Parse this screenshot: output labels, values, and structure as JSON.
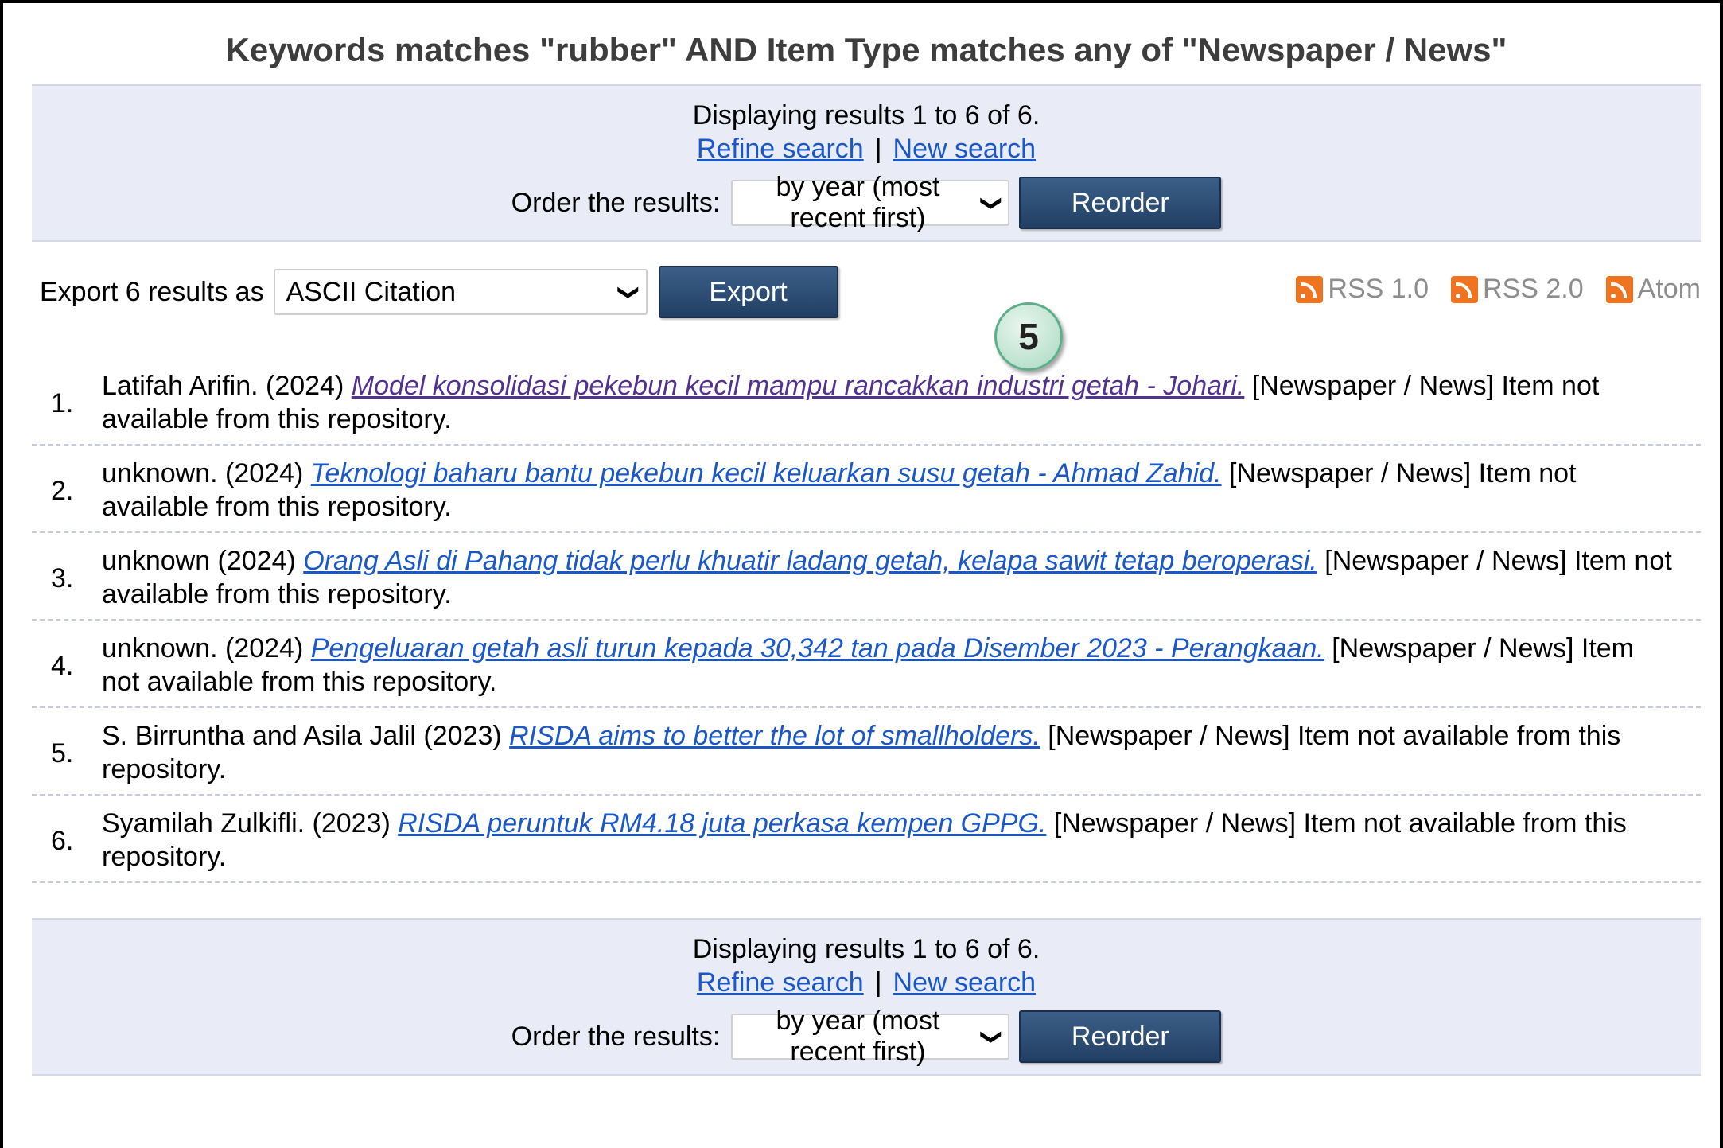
{
  "title": "Keywords matches \"rubber\" AND Item Type matches any of \"Newspaper / News\"",
  "top_bar": {
    "summary": "Displaying results 1 to 6 of 6.",
    "refine_label": "Refine search",
    "separator": "|",
    "new_search_label": "New search",
    "order_label": "Order the results:",
    "order_selected": "by year (most recent first)",
    "reorder_label": "Reorder"
  },
  "export": {
    "label": "Export 6 results as",
    "format_selected": "ASCII Citation",
    "button_label": "Export"
  },
  "feeds": [
    {
      "label": "RSS 1.0",
      "icon": "rss-icon"
    },
    {
      "label": "RSS 2.0",
      "icon": "rss-icon"
    },
    {
      "label": "Atom",
      "icon": "rss-icon"
    }
  ],
  "step_badge": "5",
  "results": [
    {
      "num": "1.",
      "prefix": "Latifah Arifin. (2024) ",
      "link": "Model konsolidasi pekebun kecil mampu rancakkan industri getah - Johari.",
      "suffix": " [Newspaper / News] Item not available from this repository."
    },
    {
      "num": "2.",
      "prefix": "unknown. (2024) ",
      "link": "Teknologi baharu bantu pekebun kecil keluarkan susu getah - Ahmad Zahid.",
      "suffix": " [Newspaper / News] Item not available from this repository."
    },
    {
      "num": "3.",
      "prefix": "unknown (2024) ",
      "link": "Orang Asli di Pahang tidak perlu khuatir ladang getah, kelapa sawit tetap beroperasi.",
      "suffix": " [Newspaper / News] Item not available from this repository."
    },
    {
      "num": "4.",
      "prefix": "unknown. (2024) ",
      "link": "Pengeluaran getah asli turun kepada 30,342 tan pada Disember 2023 - Perangkaan.",
      "suffix": " [Newspaper / News] Item not available from this repository."
    },
    {
      "num": "5.",
      "prefix": "S. Birruntha and Asila Jalil (2023) ",
      "link": "RISDA aims to better the lot of smallholders.",
      "suffix": " [Newspaper / News] Item not available from this repository."
    },
    {
      "num": "6.",
      "prefix": "Syamilah Zulkifli. (2023) ",
      "link": "RISDA peruntuk RM4.18 juta perkasa kempen GPPG.",
      "suffix": " [Newspaper / News] Item not available from this repository."
    }
  ],
  "bottom_bar": {
    "summary": "Displaying results 1 to 6 of 6.",
    "refine_label": "Refine search",
    "separator": "|",
    "new_search_label": "New search",
    "order_label": "Order the results:",
    "order_selected": "by year (most recent first)",
    "reorder_label": "Reorder"
  }
}
